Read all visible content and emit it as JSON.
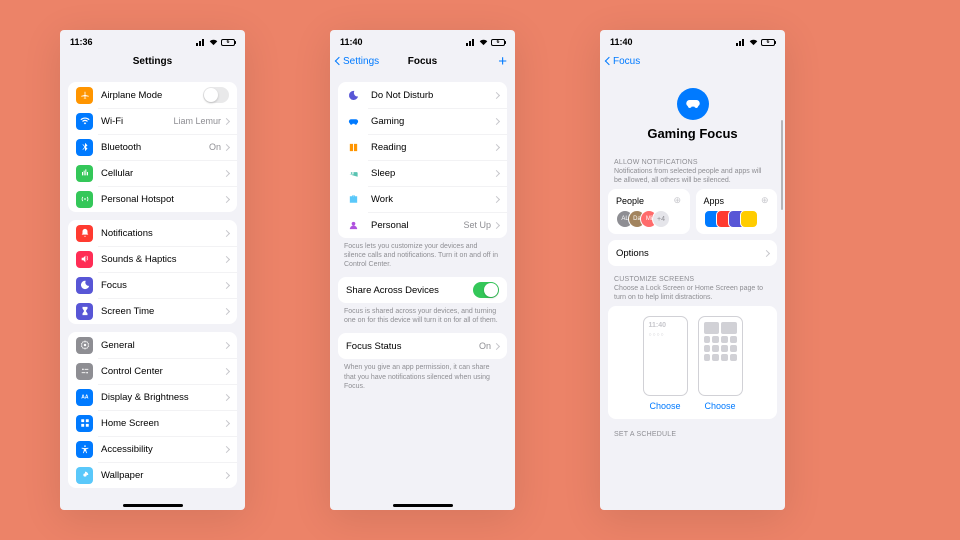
{
  "status": {
    "time1": "11:36",
    "time2": "11:40",
    "time3": "11:40",
    "batt": "6"
  },
  "phone1": {
    "title": "Settings",
    "g1": [
      {
        "label": "Airplane Mode",
        "icon": "airplane-icon",
        "color": "c-orange",
        "type": "toggle",
        "on": false
      },
      {
        "label": "Wi-Fi",
        "icon": "wifi-icon",
        "color": "c-blue",
        "value": "Liam Lemur"
      },
      {
        "label": "Bluetooth",
        "icon": "bluetooth-icon",
        "color": "c-blue",
        "value": "On"
      },
      {
        "label": "Cellular",
        "icon": "cellular-icon",
        "color": "c-green"
      },
      {
        "label": "Personal Hotspot",
        "icon": "hotspot-icon",
        "color": "c-green"
      }
    ],
    "g2": [
      {
        "label": "Notifications",
        "icon": "notifications-icon",
        "color": "c-red"
      },
      {
        "label": "Sounds & Haptics",
        "icon": "sounds-icon",
        "color": "c-red2"
      },
      {
        "label": "Focus",
        "icon": "focus-icon",
        "color": "c-indigo"
      },
      {
        "label": "Screen Time",
        "icon": "screentime-icon",
        "color": "c-indigo"
      }
    ],
    "g3": [
      {
        "label": "General",
        "icon": "general-icon",
        "color": "c-gray"
      },
      {
        "label": "Control Center",
        "icon": "controlcenter-icon",
        "color": "c-gray"
      },
      {
        "label": "Display & Brightness",
        "icon": "display-icon",
        "color": "c-blue"
      },
      {
        "label": "Home Screen",
        "icon": "homescreen-icon",
        "color": "c-blue"
      },
      {
        "label": "Accessibility",
        "icon": "accessibility-icon",
        "color": "c-blue"
      },
      {
        "label": "Wallpaper",
        "icon": "wallpaper-icon",
        "color": "c-teal"
      }
    ]
  },
  "phone2": {
    "back": "Settings",
    "title": "Focus",
    "modes": [
      {
        "label": "Do Not Disturb",
        "icon": "moon-icon",
        "tint": "#5856d6"
      },
      {
        "label": "Gaming",
        "icon": "gamectrl-icon",
        "tint": "#007aff"
      },
      {
        "label": "Reading",
        "icon": "book-icon",
        "tint": "#ff9500"
      },
      {
        "label": "Sleep",
        "icon": "bed-icon",
        "tint": "#59c3b2"
      },
      {
        "label": "Work",
        "icon": "briefcase-icon",
        "tint": "#5ac8fa"
      },
      {
        "label": "Personal",
        "icon": "person-icon",
        "tint": "#af52de",
        "value": "Set Up"
      }
    ],
    "modes_footer": "Focus lets you customize your devices and silence calls and notifications. Turn it on and off in Control Center.",
    "share": {
      "label": "Share Across Devices",
      "on": true,
      "footer": "Focus is shared across your devices, and turning one on for this device will turn it on for all of them."
    },
    "status": {
      "label": "Focus Status",
      "value": "On",
      "footer": "When you give an app permission, it can share that you have notifications silenced when using Focus."
    }
  },
  "phone3": {
    "back": "Focus",
    "hero_title": "Gaming Focus",
    "allow_head": "ALLOW NOTIFICATIONS",
    "allow_sub": "Notifications from selected people and apps will be allowed, all others will be silenced.",
    "people": {
      "title": "People",
      "extra": "+4"
    },
    "apps": {
      "title": "Apps"
    },
    "options": "Options",
    "custom_head": "CUSTOMIZE SCREENS",
    "custom_sub": "Choose a Lock Screen or Home Screen page to turn on to help limit distractions.",
    "choose": "Choose",
    "mock_time": "11:40",
    "sched_head": "SET A SCHEDULE"
  }
}
